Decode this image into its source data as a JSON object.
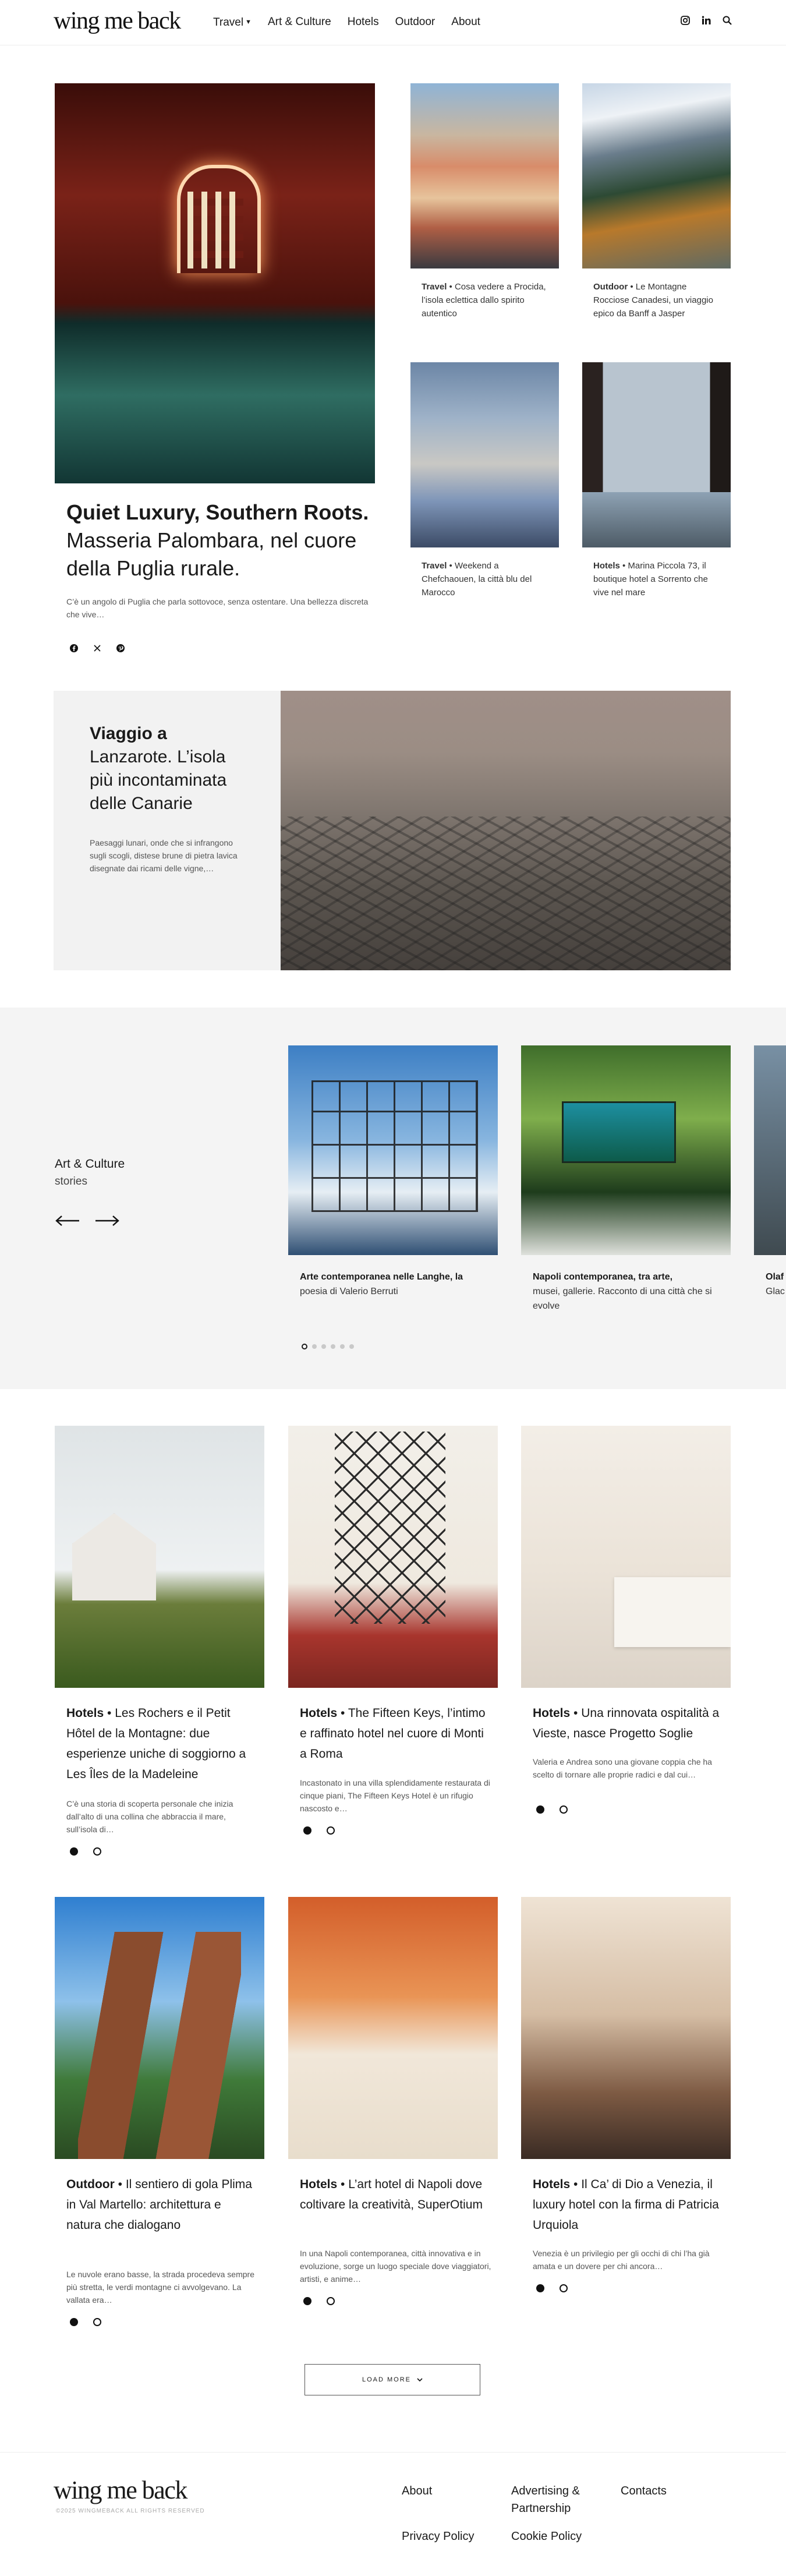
{
  "header": {
    "logo": "wing me back",
    "nav": [
      "Travel",
      "Art & Culture",
      "Hotels",
      "Outdoor",
      "About"
    ],
    "icons": [
      "instagram-icon",
      "linkedin-icon",
      "search-icon"
    ]
  },
  "hero": {
    "title_bold": "Quiet Luxury, Southern Roots.",
    "title_rest": "Masseria Palombara, nel cuore della Puglia rurale.",
    "excerpt": "C’è un angolo di Puglia che parla sottovoce, senza ostentare. Una bellezza discreta che vive…"
  },
  "side_cards": [
    {
      "category": "Travel",
      "text": "• Cosa vedere a Procida, l’isola eclettica dallo spirito autentico"
    },
    {
      "category": "Outdoor",
      "text": "• Le Montagne Rocciose Canadesi, un viaggio epico da Banff a Jasper"
    },
    {
      "category": "Travel",
      "text": "• Weekend a Chefchaouen, la città blu del Marocco"
    },
    {
      "category": "Hotels",
      "text": "• Marina Piccola 73, il boutique hotel a Sorrento che vive nel mare"
    }
  ],
  "feature": {
    "title_bold": "Viaggio a",
    "title_rest": "Lanzarote. L’isola più incontaminata delle Canarie",
    "excerpt": "Paesaggi lunari, onde che si infrangono sugli scogli, distese brune di pietra lavica disegnate dai ricami delle vigne,…"
  },
  "art_section": {
    "heading": "Art & Culture",
    "subheading": "stories",
    "cards": [
      {
        "title": "Arte contemporanea nelle Langhe, la",
        "sub": "poesia di Valerio Berruti"
      },
      {
        "title": "Napoli contemporanea, tra arte,",
        "sub": "musei, gallerie. Racconto di una città che si evolve"
      },
      {
        "title": "Olaf",
        "sub": "Glac"
      }
    ],
    "slide_count": 6,
    "active_slide": 1
  },
  "grid": [
    {
      "category": "Hotels",
      "title": "• Les Rochers e il Petit Hôtel de la Montagne: due esperienze uniche di soggiorno a Les Îles de la Madeleine",
      "excerpt": "C’è una storia di scoperta personale che inizia dall’alto di una collina che abbraccia il mare, sull’isola di…"
    },
    {
      "category": "Hotels",
      "title": "• The Fifteen Keys, l’intimo e raffinato hotel nel cuore di Monti a Roma",
      "excerpt": "Incastonato in una villa splendidamente restaurata di cinque piani, The Fifteen Keys Hotel è un rifugio nascosto e…"
    },
    {
      "category": "Hotels",
      "title": "• Una rinnovata ospitalità a Vieste, nasce Progetto Soglie",
      "excerpt": "Valeria e Andrea sono una giovane coppia che ha scelto di tornare alle proprie radici e dal cui…"
    },
    {
      "category": "Outdoor",
      "title": "• Il sentiero di gola Plima in Val Martello: architettura e natura che dialogano",
      "excerpt": "Le nuvole erano basse, la strada procedeva sempre più stretta, le verdi montagne ci avvolgevano. La vallata era…"
    },
    {
      "category": "Hotels",
      "title": "• L’art hotel di Napoli dove coltivare la creatività, SuperOtium",
      "excerpt": "In una Napoli contemporanea, città innovativa e in evoluzione, sorge un luogo speciale dove viaggiatori, artisti, e anime…"
    },
    {
      "category": "Hotels",
      "title": "• Il Ca’ di Dio a Venezia, il luxury hotel con la firma di Patricia Urquiola",
      "excerpt": "Venezia è un privilegio per gli occhi di chi l’ha già amata e un dovere per chi ancora…"
    }
  ],
  "load_more": "LOAD MORE",
  "footer": {
    "logo": "wing me back",
    "copyright": "©2025 WINGMEBACK ALL RIGHTS RESERVED",
    "links": [
      "About",
      "Advertising & Partnership",
      "Contacts",
      "Privacy Policy",
      "Cookie Policy"
    ]
  }
}
